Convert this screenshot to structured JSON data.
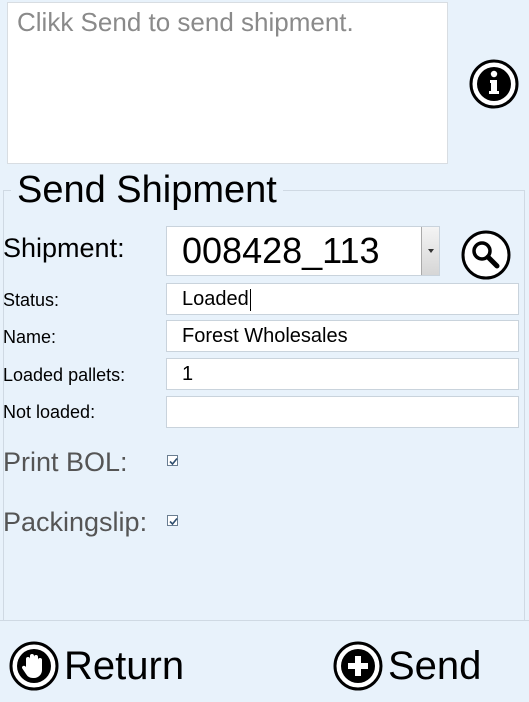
{
  "message": {
    "text": "Clikk Send to send shipment."
  },
  "section": {
    "title": "Send Shipment"
  },
  "shipment": {
    "label": "Shipment:",
    "value": "008428_113"
  },
  "status": {
    "label": "Status:",
    "value": "Loaded"
  },
  "name": {
    "label": "Name:",
    "value": "Forest Wholesales"
  },
  "loaded_pallets": {
    "label": "Loaded pallets:",
    "value": "1"
  },
  "not_loaded": {
    "label": "Not loaded:",
    "value": ""
  },
  "print_bol": {
    "label": "Print BOL:",
    "checked": true
  },
  "packingslip": {
    "label": "Packingslip:",
    "checked": true
  },
  "buttons": {
    "return_label": "Return",
    "send_label": "Send"
  },
  "icons": {
    "info": "info-icon",
    "search": "search-icon",
    "return": "stop-hand-icon",
    "send": "plus-icon"
  }
}
